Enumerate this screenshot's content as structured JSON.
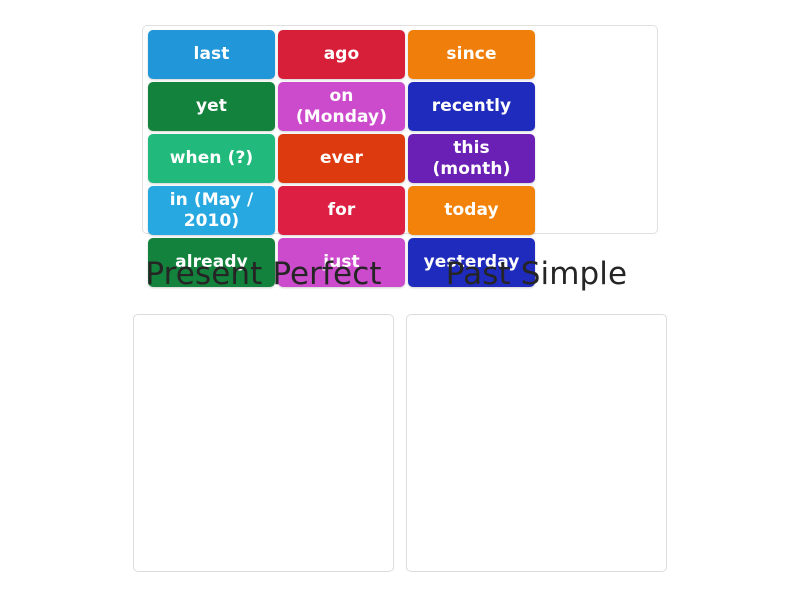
{
  "activity": {
    "type": "group-sort",
    "tile_pool": {
      "name": "word-bank",
      "tiles": [
        {
          "label": "last",
          "color": "#2196d8"
        },
        {
          "label": "ago",
          "color": "#d81f39"
        },
        {
          "label": "since",
          "color": "#f07e0a"
        },
        {
          "label": "yet",
          "color": "#13823c"
        },
        {
          "label": "on (Monday)",
          "color": "#cc4bcc"
        },
        {
          "label": "recently",
          "color": "#1f2bbd"
        },
        {
          "label": "when (?)",
          "color": "#21b97c"
        },
        {
          "label": "ever",
          "color": "#dd3a10"
        },
        {
          "label": "this (month)",
          "color": "#6a1fb5"
        },
        {
          "label": "in (May / 2010)",
          "color": "#27a8e0"
        },
        {
          "label": "for",
          "color": "#dc1f42"
        },
        {
          "label": "today",
          "color": "#f28209"
        },
        {
          "label": "already",
          "color": "#13823c"
        },
        {
          "label": "just",
          "color": "#cc4bcc"
        },
        {
          "label": "yesterday",
          "color": "#1f2bbd"
        },
        {
          "label": "",
          "color": "transparent"
        }
      ]
    },
    "categories": [
      {
        "heading": "Present Perfect",
        "items": []
      },
      {
        "heading": "Past Simple",
        "items": []
      }
    ]
  }
}
